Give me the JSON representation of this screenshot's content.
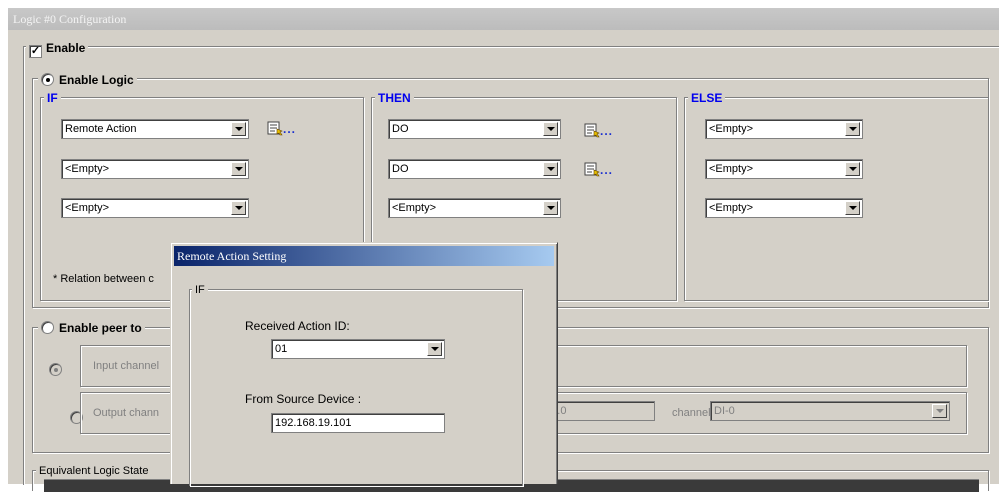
{
  "window": {
    "title": "Logic #0 Configuration"
  },
  "enable": {
    "label": "Enable",
    "checked": true
  },
  "enable_logic": {
    "label": "Enable Logic",
    "selected": true
  },
  "if_group": {
    "legend": "IF",
    "rows": [
      "Remote Action",
      "<Empty>",
      "<Empty>"
    ],
    "settings_dots": "...",
    "relation_note": "* Relation between c"
  },
  "then_group": {
    "legend": "THEN",
    "rows": [
      "DO",
      "DO",
      "<Empty>"
    ],
    "settings_dots": "..."
  },
  "else_group": {
    "legend": "ELSE",
    "rows": [
      "<Empty>",
      "<Empty>",
      "<Empty>"
    ]
  },
  "peer": {
    "label": "Enable peer to",
    "input_channel": "Input channel",
    "output_channel": "Output chann",
    "ip_partial": "0.0.0",
    "channel_label": "channel",
    "channel_value": "DI-0"
  },
  "equivalent": {
    "legend": "Equivalent Logic State"
  },
  "dialog": {
    "title": "Remote Action Setting",
    "group_legend": "IF",
    "received_label": "Received Action ID:",
    "received_value": "01",
    "source_label": "From Source Device :",
    "source_value": "192.168.19.101"
  },
  "colors": {
    "legend_blue": "#0000ee",
    "dialog_title": "#0a246a"
  },
  "icons": {
    "settings": "settings-table-icon"
  }
}
